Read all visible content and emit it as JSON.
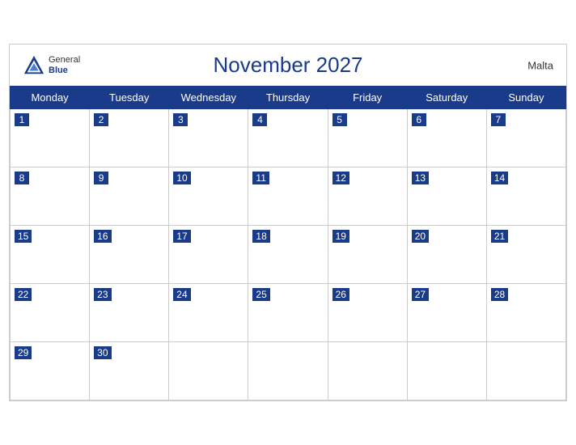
{
  "calendar": {
    "title": "November 2027",
    "country": "Malta",
    "logo": {
      "line1": "General",
      "line2": "Blue"
    },
    "days_of_week": [
      "Monday",
      "Tuesday",
      "Wednesday",
      "Thursday",
      "Friday",
      "Saturday",
      "Sunday"
    ],
    "weeks": [
      [
        1,
        2,
        3,
        4,
        5,
        6,
        7
      ],
      [
        8,
        9,
        10,
        11,
        12,
        13,
        14
      ],
      [
        15,
        16,
        17,
        18,
        19,
        20,
        21
      ],
      [
        22,
        23,
        24,
        25,
        26,
        27,
        28
      ],
      [
        29,
        30,
        null,
        null,
        null,
        null,
        null
      ]
    ]
  }
}
